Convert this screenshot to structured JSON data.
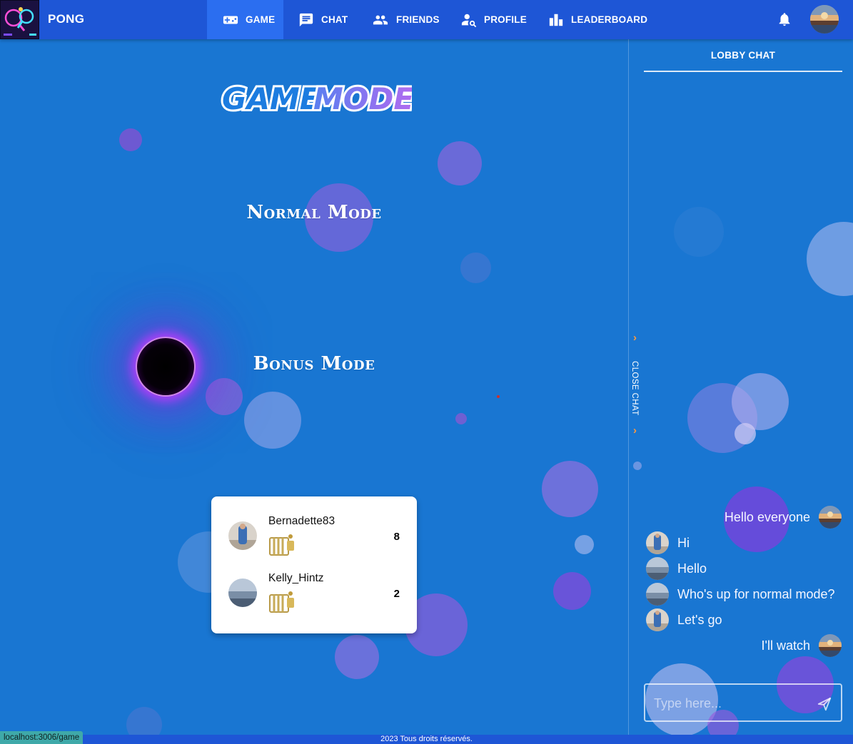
{
  "app": {
    "brand": "PONG"
  },
  "nav": {
    "tabs": [
      {
        "label": "GAME",
        "icon": "gamepad-icon",
        "active": true
      },
      {
        "label": "CHAT",
        "icon": "chat-icon",
        "active": false
      },
      {
        "label": "FRIENDS",
        "icon": "friends-icon",
        "active": false
      },
      {
        "label": "PROFILE",
        "icon": "profile-search-icon",
        "active": false
      },
      {
        "label": "LEADERBOARD",
        "icon": "leaderboard-icon",
        "active": false
      }
    ],
    "notifications_icon": "bell-icon"
  },
  "game": {
    "title_part1": "GAME",
    "title_part2": "MODE",
    "modes": [
      {
        "label": "Normal Mode"
      },
      {
        "label": "Bonus Mode"
      }
    ],
    "scoreboard": [
      {
        "name": "Bernadette83",
        "score": "8"
      },
      {
        "name": "Kelly_Hintz",
        "score": "2"
      }
    ]
  },
  "chat": {
    "title": "LOBBY CHAT",
    "close_label": "CLOSE CHAT",
    "messages": [
      {
        "text": "Hello everyone",
        "side": "right"
      },
      {
        "text": "Hi",
        "side": "left"
      },
      {
        "text": "Hello",
        "side": "left"
      },
      {
        "text": "Who's up for normal mode?",
        "side": "left"
      },
      {
        "text": "Let's go",
        "side": "left"
      },
      {
        "text": "I'll watch",
        "side": "right"
      }
    ],
    "input_placeholder": "Type here...",
    "send_icon": "send-icon"
  },
  "footer": {
    "copyright": "2023 Tous droits réservés."
  },
  "status_bar": {
    "url": "localhost:3006/game"
  },
  "colors": {
    "background": "#1976d2",
    "navbar": "#1e56d6",
    "active_tab": "#2b6ef0",
    "bubble_purple": "#8a5cd6",
    "arrow_orange": "#ff9a3d"
  }
}
